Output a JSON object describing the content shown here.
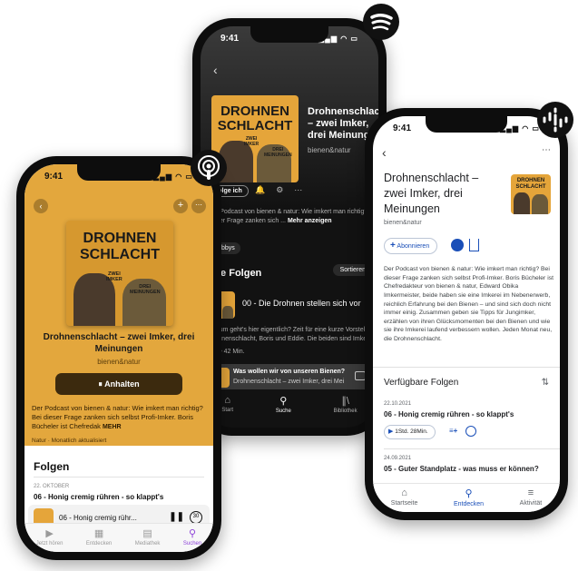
{
  "cover": {
    "line1": "DROHNEN",
    "line2": "SCHLACHT",
    "sub1": "ZWEI",
    "sub2": "IMKER",
    "sub3": "DREI",
    "sub4": "MEINUNGEN"
  },
  "spotify": {
    "time": "9:41",
    "title": "Drohnenschlacht – zwei Imker, drei Meinungen",
    "author": "bienen&natur",
    "follow": "Folge ich",
    "desc": "Der Podcast von bienen & natur: Wie imkert man richtig? Bei dieser Frage zanken sich ...",
    "more": "Mehr anzeigen",
    "tag": "Hobbys",
    "episodes_header": "Alle Folgen",
    "sort": "Sortieren",
    "episode_title": "00 - Die Drohnen stellen sich vor",
    "episode_desc": "Worum geht's hier eigentlich? Zeit für eine kurze Vorstellung: Drohnenschlacht, Boris und Eddie. Die beiden sind Imker",
    "episode_meta": "Mai • 42 Min.",
    "mini_title": "Was wollen wir von unseren Bienen?",
    "mini_sub": "Drohnenschlacht – zwei Imker, drei Mei",
    "nav": [
      "Start",
      "Suche",
      "Bibliothek"
    ]
  },
  "apple": {
    "time": "9:41",
    "title": "Drohnenschlacht – zwei Imker, drei Meinungen",
    "author": "bienen&natur",
    "listen": "⏸ Anhalten",
    "desc": "Der Podcast von bienen & natur: Wie imkert man richtig? Bei dieser Frage zanken sich selbst Profi-Imker. Boris Bücheler ist Chefredak",
    "more": "MEHR",
    "meta": "Natur · Monatlich aktualisiert",
    "episodes_header": "Folgen",
    "date": "22. OKTOBER",
    "episode_title": "06 - Honig cremig rühren - so klappt's",
    "mini_title": "06 - Honig cremig rühr...",
    "nav": [
      "Jetzt hören",
      "Entdecken",
      "Mediathek",
      "Suchen"
    ]
  },
  "google": {
    "time": "9:41",
    "title": "Drohnenschlacht – zwei Imker, drei Meinungen",
    "author": "bienen&natur",
    "subscribe": "Abonnieren",
    "desc": "Der Podcast von bienen & natur: Wie imkert man richtig? Bei dieser Frage zanken sich selbst Profi-Imker. Boris Bücheler ist Chefredakteur von bienen & natur, Edward Obika Imkermeister, beide haben sie eine Imkerei im Nebenerwerb, reichlich Erfahrung bei den Bienen – und sind sich doch nicht immer einig. Zusammen geben sie Tipps für Jungimker, erzählen von ihren Glücksmomenten bei den Bienen und wie sie ihre Imkerei laufend verbessern wollen. Jeden Monat neu, die Drohnenschlacht.",
    "episodes_header": "Verfügbare Folgen",
    "date1": "22.10.2021",
    "episode1": "06 - Honig cremig rühren - so klappt's",
    "duration1": "1Std. 28Min.",
    "date2": "24.09.2021",
    "episode2": "05 - Guter Standplatz - was muss er können?",
    "nav": [
      "Startseite",
      "Entdecken",
      "Aktivität"
    ]
  },
  "colors": {
    "spotify_green": "#1db954",
    "apple_purple": "#8e44d8",
    "google_blue": "#1a4fb8",
    "cover_gold": "#e5a53a"
  }
}
